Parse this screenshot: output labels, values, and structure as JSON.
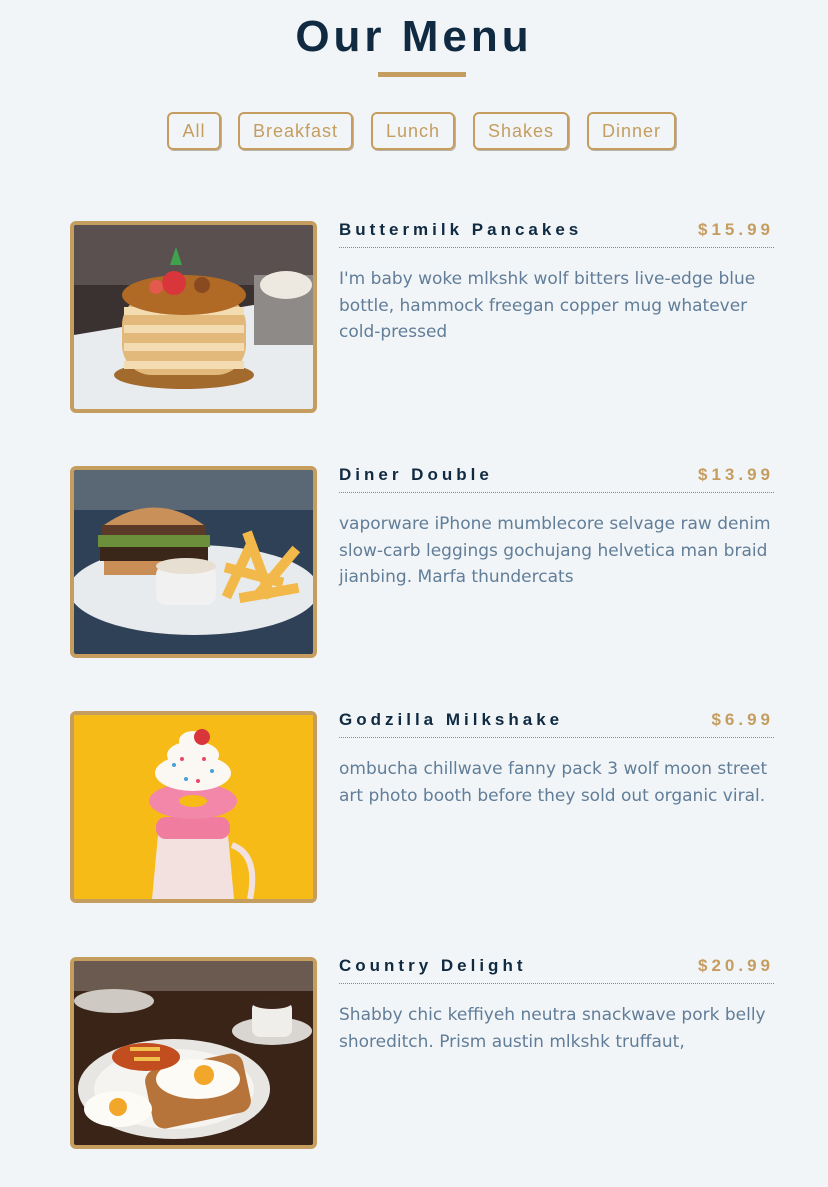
{
  "page": {
    "title": "Our Menu"
  },
  "filters": [
    {
      "label": "All"
    },
    {
      "label": "Breakfast"
    },
    {
      "label": "Lunch"
    },
    {
      "label": "Shakes"
    },
    {
      "label": "Dinner"
    }
  ],
  "items": [
    {
      "name": "Buttermilk Pancakes",
      "price": "$15.99",
      "desc": "I'm baby woke mlkshk wolf bitters live-edge blue bottle, hammock freegan copper mug whatever cold-pressed",
      "image": "pancakes"
    },
    {
      "name": "Diner Double",
      "price": "$13.99",
      "desc": "vaporware iPhone mumblecore selvage raw denim slow-carb leggings gochujang helvetica man braid jianbing. Marfa thundercats",
      "image": "burger-and-fries"
    },
    {
      "name": "Godzilla Milkshake",
      "price": "$6.99",
      "desc": "ombucha chillwave fanny pack 3 wolf moon street art photo booth before they sold out organic viral.",
      "image": "milkshake"
    },
    {
      "name": "Country Delight",
      "price": "$20.99",
      "desc": "Shabby chic keffiyeh neutra snackwave pork belly shoreditch. Prism austin mlkshk truffaut,",
      "image": "eggs-and-toast"
    }
  ],
  "colors": {
    "accent": "#c59d5f",
    "title": "#102a42",
    "text": "#617d98",
    "background": "#f1f5f8"
  }
}
